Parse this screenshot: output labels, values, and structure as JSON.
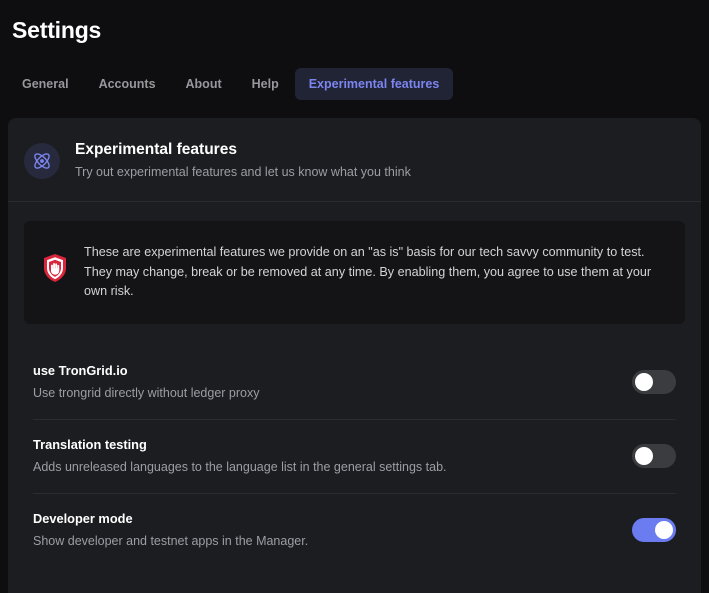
{
  "window": {
    "title": "Settings"
  },
  "tabs": [
    {
      "label": "General",
      "active": false
    },
    {
      "label": "Accounts",
      "active": false
    },
    {
      "label": "About",
      "active": false
    },
    {
      "label": "Help",
      "active": false
    },
    {
      "label": "Experimental features",
      "active": true
    }
  ],
  "section": {
    "icon": "atom-icon",
    "heading": "Experimental features",
    "subtitle": "Try out experimental features and let us know what you think"
  },
  "callout": {
    "icon": "shield-hand-icon",
    "text": "These are experimental features we provide on an \"as is\" basis for our tech savvy community to test. They may change, break or be removed at any time. By enabling them, you agree to use them at your own risk."
  },
  "settings": [
    {
      "label": "use TronGrid.io",
      "description": "Use trongrid directly without ledger proxy",
      "enabled": false
    },
    {
      "label": "Translation testing",
      "description": "Adds unreleased languages to the language list in the general settings tab.",
      "enabled": false
    },
    {
      "label": "Developer mode",
      "description": "Show developer and testnet apps in the Manager.",
      "enabled": true
    }
  ],
  "colors": {
    "page_background": "#0e0e10",
    "panel_background": "#1c1d20",
    "callout_background": "#141416",
    "accent": "#6a7cf0",
    "active_tab_text": "#7c85ef",
    "active_tab_background": "#212435",
    "warning_red": "#d9263c",
    "muted_text": "#9d9da3"
  }
}
